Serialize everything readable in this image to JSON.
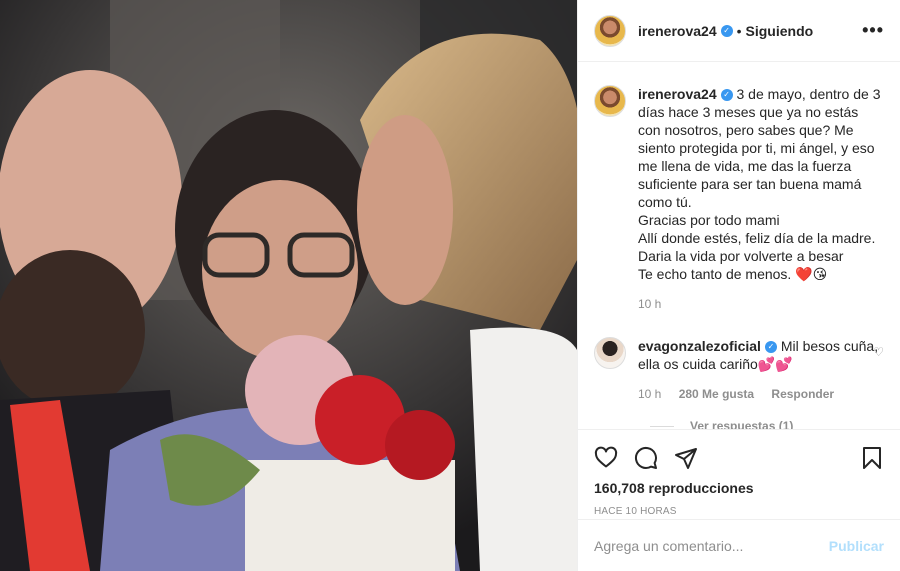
{
  "post": {
    "username": "irenerova24",
    "separator": "•",
    "follow_status": "Siguiendo",
    "more_icon": "more-horizontal-icon",
    "caption": "3 de mayo, dentro de 3 días hace 3 meses que ya no estás con nosotros, pero sabes que? Me siento protegida por ti, mi ángel, y eso me llena de vida, me das la fuerza suficiente para ser tan buena mamá como tú.\nGracias por todo mami\nAllí donde estés, feliz día de la madre.\nDaria la vida por volverte a besar\nTe echo tanto de menos. ❤️😘",
    "caption_time": "10 h"
  },
  "comment": {
    "username": "evagonzalezoficial",
    "text": "Mil besos cuña, ella os cuida cariño💕💕",
    "time": "10 h",
    "likes": "280 Me gusta",
    "reply": "Responder",
    "view_replies": "Ver respuestas (1)"
  },
  "stats": {
    "views": "160,708 reproducciones",
    "ago": "HACE 10 HORAS"
  },
  "composer": {
    "placeholder": "Agrega un comentario...",
    "publish": "Publicar"
  },
  "colors": {
    "verified": "#3897f0",
    "muted": "#8e8e8e",
    "publish_disabled": "#b2dffc"
  }
}
